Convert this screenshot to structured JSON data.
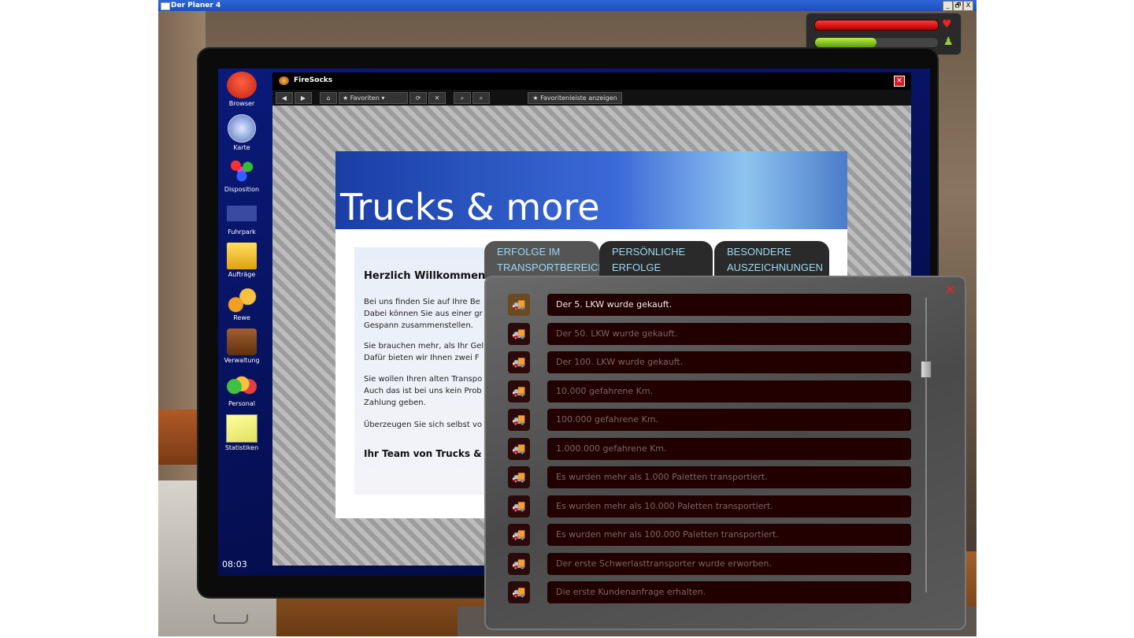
{
  "window": {
    "title": "Der Planer 4",
    "buttons": [
      "_",
      "🗗",
      "X"
    ]
  },
  "hud": {
    "health_level": 1.0,
    "satisfaction_level": 0.5
  },
  "desktop": {
    "icons": [
      {
        "label": "Browser",
        "icon": "browser-icon"
      },
      {
        "label": "Karte",
        "icon": "compass-icon"
      },
      {
        "label": "Disposition",
        "icon": "disposition-icon"
      },
      {
        "label": "Fuhrpark",
        "icon": "truck-icon"
      },
      {
        "label": "Aufträge",
        "icon": "folder-icon"
      },
      {
        "label": "Rewe",
        "icon": "money-icon"
      },
      {
        "label": "Verwaltung",
        "icon": "briefcase-icon"
      },
      {
        "label": "Personal",
        "icon": "people-icon"
      },
      {
        "label": "Statistiken",
        "icon": "chart-icon"
      }
    ],
    "clock": "08:03"
  },
  "browser": {
    "title": "FireSocks",
    "favorites_label": "Favoriten",
    "favorites_bar_label": "Favoritenleiste anzeigen",
    "page": {
      "banner_title": "Trucks & more",
      "heading": "Herzlich Willkommen in",
      "paragraphs": [
        "Bei uns finden Sie auf Ihre Be\nDabei können Sie aus einer gr\nGespann zusammenstellen.",
        "Sie brauchen mehr, als Ihr Gel\nDafür bieten wir Ihnen zwei F",
        "Sie wollen Ihren alten Transpo\nAuch das ist bei uns kein Prob\nZahlung geben.",
        "Überzeugen Sie sich selbst vo"
      ],
      "signature": "Ihr Team von Trucks & m"
    }
  },
  "achievements": {
    "tabs": [
      {
        "label": "ERFOLGE IM\nTRANSPORTBEREICH",
        "active": true
      },
      {
        "label": "PERSÖNLICHE\nERFOLGE",
        "active": false
      },
      {
        "label": "BESONDERE\nAUSZEICHNUNGEN",
        "active": false
      }
    ],
    "close_label": "✕",
    "items": [
      {
        "text": "Der 5. LKW wurde gekauft.",
        "achieved": true
      },
      {
        "text": "Der 50. LKW wurde gekauft.",
        "achieved": false
      },
      {
        "text": "Der 100. LKW wurde gekauft.",
        "achieved": false
      },
      {
        "text": "10.000 gefahrene Km.",
        "achieved": false
      },
      {
        "text": "100.000 gefahrene Km.",
        "achieved": false
      },
      {
        "text": "1.000.000 gefahrene Km.",
        "achieved": false
      },
      {
        "text": "Es wurden mehr als 1.000 Paletten transportiert.",
        "achieved": false
      },
      {
        "text": "Es wurden mehr als 10.000 Paletten transportiert.",
        "achieved": false
      },
      {
        "text": "Es wurden mehr als 100.000 Paletten transportiert.",
        "achieved": false
      },
      {
        "text": "Der erste Schwerlasttransporter wurde erworben.",
        "achieved": false
      },
      {
        "text": "Die erste Kundenanfrage erhalten.",
        "achieved": false
      }
    ]
  }
}
